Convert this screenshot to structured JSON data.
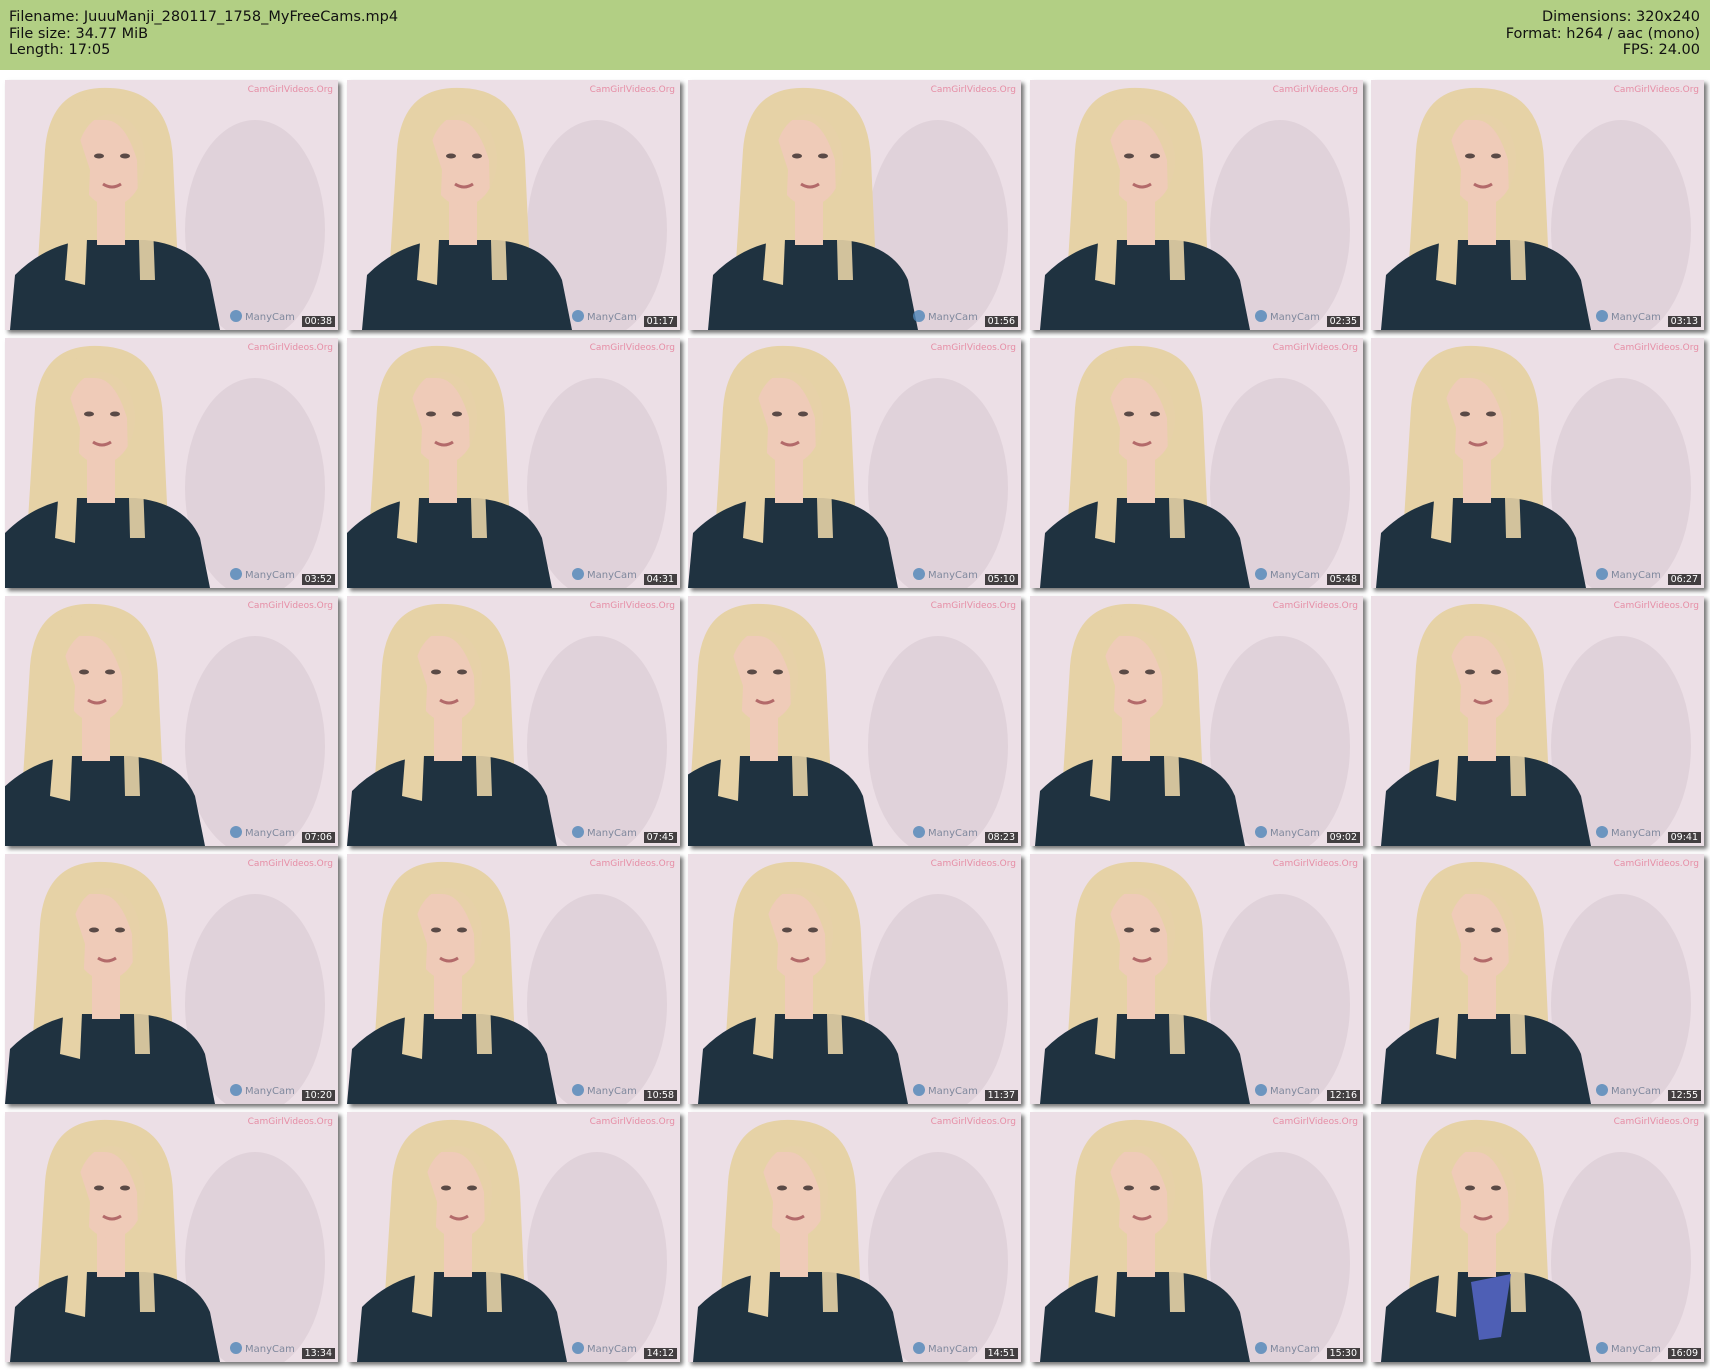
{
  "header": {
    "filename_line": "Filename: JuuuManji_280117_1758_MyFreeCams.mp4",
    "filesize_line": "File size: 34.77 MiB",
    "length_line": "Length: 17:05",
    "dimensions_line": "Dimensions: 320x240",
    "format_line": "Format: h264 / aac (mono)",
    "fps_line": "FPS: 24.00"
  },
  "thumbnails": [
    {
      "time": "00:38"
    },
    {
      "time": "01:17"
    },
    {
      "time": "01:56"
    },
    {
      "time": "02:35"
    },
    {
      "time": "03:13"
    },
    {
      "time": "03:52"
    },
    {
      "time": "04:31"
    },
    {
      "time": "05:10"
    },
    {
      "time": "05:48"
    },
    {
      "time": "06:27"
    },
    {
      "time": "07:06"
    },
    {
      "time": "07:45"
    },
    {
      "time": "08:23"
    },
    {
      "time": "09:02"
    },
    {
      "time": "09:41"
    },
    {
      "time": "10:20"
    },
    {
      "time": "10:58"
    },
    {
      "time": "11:37"
    },
    {
      "time": "12:16"
    },
    {
      "time": "12:55"
    },
    {
      "time": "13:34"
    },
    {
      "time": "14:12"
    },
    {
      "time": "14:51"
    },
    {
      "time": "15:30"
    },
    {
      "time": "16:09"
    }
  ],
  "colors": {
    "header_bg": "#b2cf84",
    "wall": "#ecdfe6",
    "shirt": "#1f3240",
    "hair": "#e6d2a6",
    "skin": "#efcbb8",
    "watermark": "#e57f9a",
    "cup": "#4e5fb5"
  }
}
